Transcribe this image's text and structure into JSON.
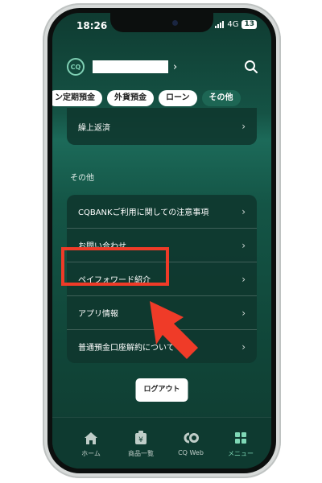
{
  "status": {
    "time": "18:26",
    "network": "4G",
    "battery": "13"
  },
  "header": {
    "logo_text": "CQ"
  },
  "chips": [
    "ン定期預金",
    "外貨預金",
    "ローン",
    "その他"
  ],
  "card1": {
    "items": [
      {
        "label": "繰上返済"
      }
    ]
  },
  "section": {
    "label": "その他"
  },
  "card2": {
    "items": [
      {
        "label": "CQBANKご利用に関しての注意事項"
      },
      {
        "label": "お問い合わせ"
      },
      {
        "label": "ペイフォワード紹介"
      },
      {
        "label": "アプリ情報"
      },
      {
        "label": "普通預金口座解約について"
      }
    ]
  },
  "logout_label": "ログアウト",
  "tabs": [
    {
      "label": "ホーム",
      "icon": "home-icon"
    },
    {
      "label": "商品一覧",
      "icon": "products-icon"
    },
    {
      "label": "CQ Web",
      "icon": "cq-web-icon"
    },
    {
      "label": "メニュー",
      "icon": "menu-grid-icon"
    }
  ],
  "colors": {
    "accent": "#7fd8b6",
    "highlight": "#ef3b28",
    "background": "#155345"
  }
}
